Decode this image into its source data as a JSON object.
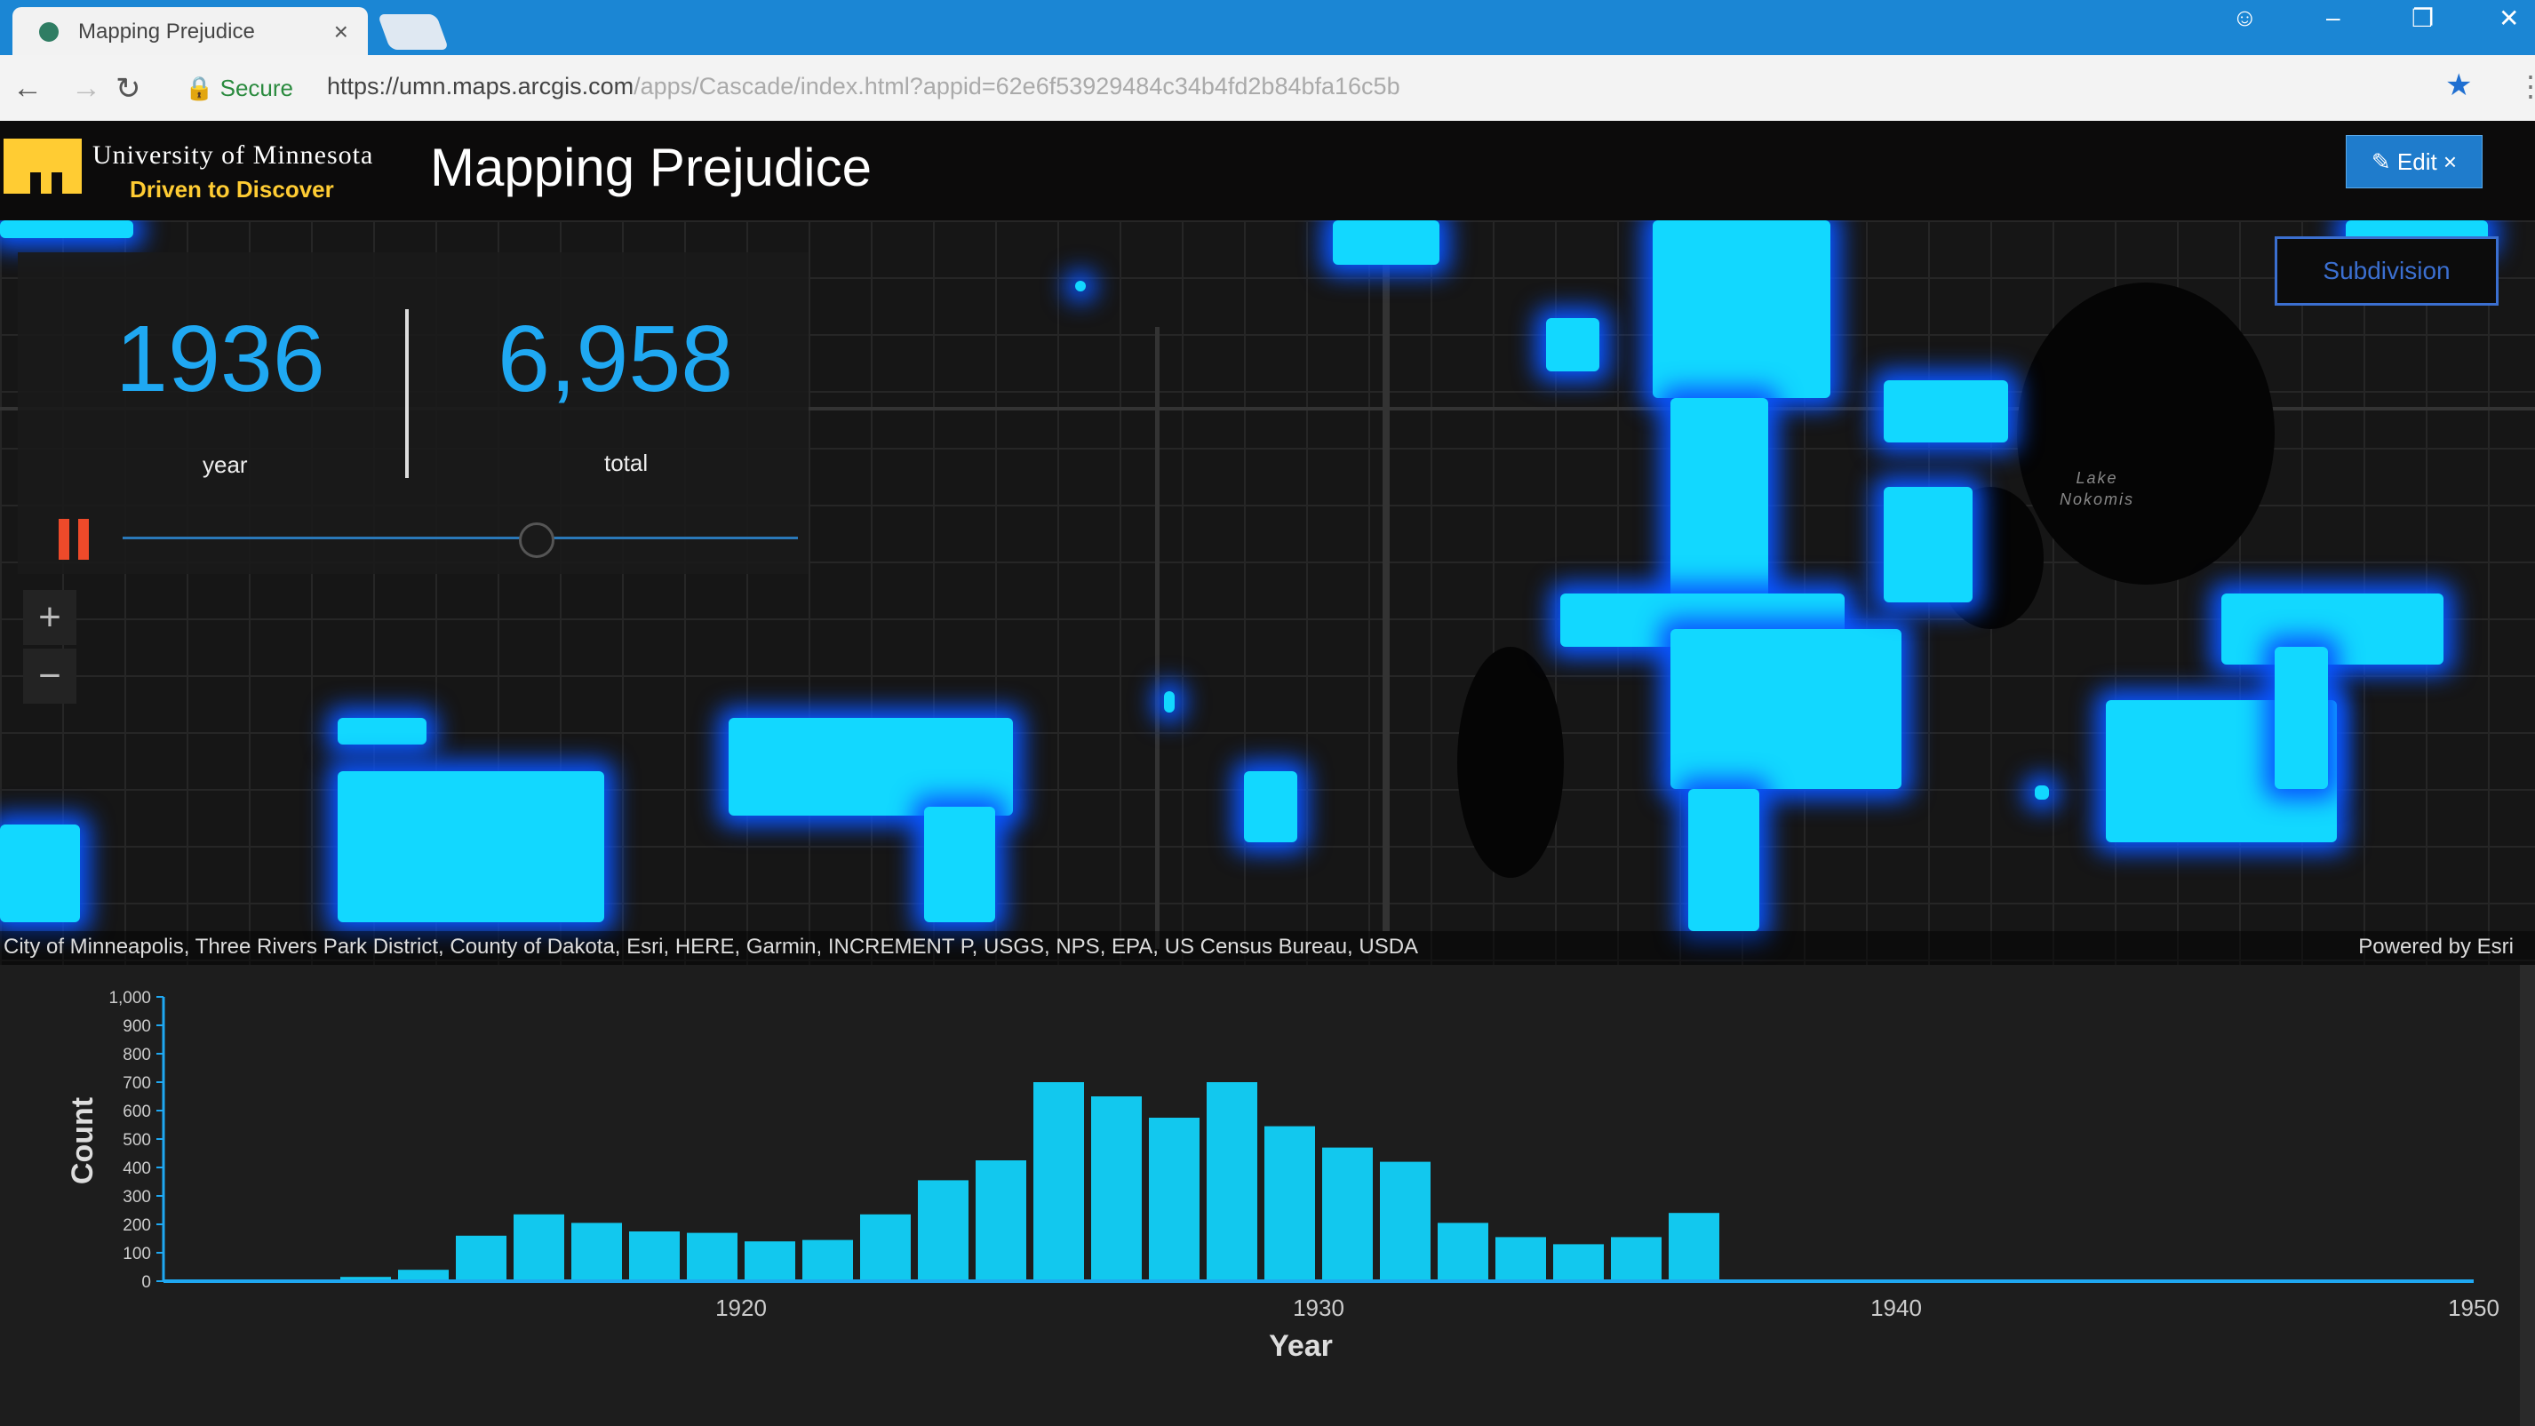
{
  "browser": {
    "tab_title": "Mapping Prejudice",
    "tab_close": "×",
    "secure_label": "Secure",
    "url_host": "https://umn.maps.arcgis.com",
    "url_path": "/apps/Cascade/index.html?appid=62e6f53929484c34b4fd2b84bfa16c5b",
    "icons": [
      "back-arrow-icon",
      "forward-arrow-icon",
      "reload-icon",
      "lock-icon",
      "star-icon",
      "menu-icon"
    ]
  },
  "header": {
    "university": "University of Minnesota",
    "tagline": "Driven to Discover",
    "title": "Mapping Prejudice",
    "edit_label": "Edit"
  },
  "map": {
    "subdivision_button": "Subdivision",
    "lake_label_1": "Lake",
    "lake_label_2": "Nokomis",
    "attribution": "City of Minneapolis, Three Rivers Park District, County of Dakota, Esri, HERE, Garmin, INCREMENT P, USGS, NPS, EPA, US Census Bureau, USDA",
    "powered_by": "Powered by Esri",
    "zoom_in": "+",
    "zoom_out": "−"
  },
  "stats": {
    "year": "1936",
    "year_label": "year",
    "total": "6,958",
    "total_label": "total",
    "timeline_progress": 0.6
  },
  "colors": {
    "accent": "#1fa8f2",
    "covenant": "#12d8ff",
    "glow": "#0a55ff",
    "pause": "#ee4a2a",
    "gold": "#ffcc33"
  },
  "chart_data": {
    "type": "bar",
    "title": "",
    "xlabel": "Year",
    "ylabel": "Count",
    "xlim": [
      1910,
      1950
    ],
    "ylim": [
      0,
      1000
    ],
    "yticks": [
      "0",
      "100",
      "200",
      "300",
      "400",
      "500",
      "600",
      "700",
      "800",
      "900",
      "1,000"
    ],
    "xticks": [
      "1920",
      "1930",
      "1940",
      "1950"
    ],
    "x": [
      1912,
      1913,
      1914,
      1915,
      1916,
      1917,
      1918,
      1919,
      1920,
      1921,
      1922,
      1923,
      1924,
      1925,
      1926,
      1927,
      1928,
      1929,
      1930,
      1931,
      1932,
      1933,
      1934,
      1935,
      1936
    ],
    "values": [
      5,
      15,
      40,
      160,
      235,
      205,
      175,
      170,
      140,
      145,
      235,
      355,
      425,
      700,
      650,
      575,
      700,
      545,
      470,
      420,
      205,
      155,
      130,
      155,
      240
    ]
  }
}
